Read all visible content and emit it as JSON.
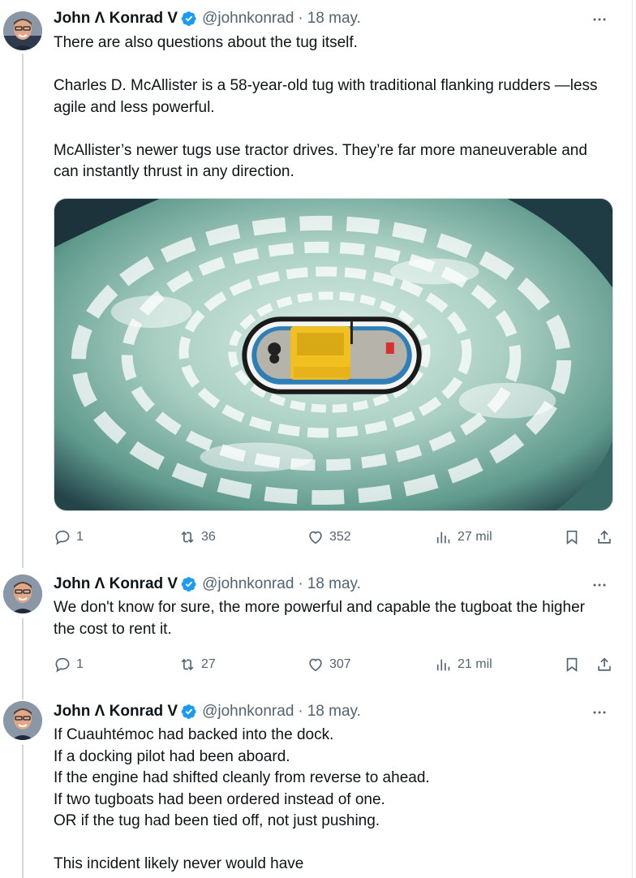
{
  "author": {
    "name": "John Λ Konrad V",
    "handle": "@johnkonrad",
    "verified": true,
    "verified_color": "#1d9bf0"
  },
  "tweets": [
    {
      "date": "18 may.",
      "paragraphs": [
        "There are also questions about the tug itself.",
        "Charles D. McAllister is a 58-year-old tug with traditional flanking rudders —less agile and less powerful.",
        "McAllister’s newer tugs use tractor drives. They’re far more maneuverable and can instantly thrust in any direction."
      ],
      "has_media": true,
      "replies": "1",
      "reposts": "36",
      "likes": "352",
      "views": "27 mil"
    },
    {
      "date": "18 may.",
      "paragraphs": [
        "We don't know for sure, the more powerful and capable the tugboat the higher the cost to rent it."
      ],
      "has_media": false,
      "replies": "1",
      "reposts": "27",
      "likes": "307",
      "views": "21 mil"
    },
    {
      "date": "18 may.",
      "lines": [
        "If Cuauhtémoc had backed into the dock.",
        "If a docking pilot had been aboard.",
        "If the engine had shifted cleanly from reverse to ahead.",
        "If two tugboats had been ordered instead of one.",
        "OR if the tug had been tied off, not just pushing."
      ],
      "closing": "This incident likely never would have"
    }
  ],
  "icons": {
    "more": "more-dots-icon",
    "reply": "reply-icon",
    "repost": "repost-icon",
    "like": "heart-icon",
    "views": "views-chart-icon",
    "bookmark": "bookmark-icon",
    "share": "share-icon"
  }
}
